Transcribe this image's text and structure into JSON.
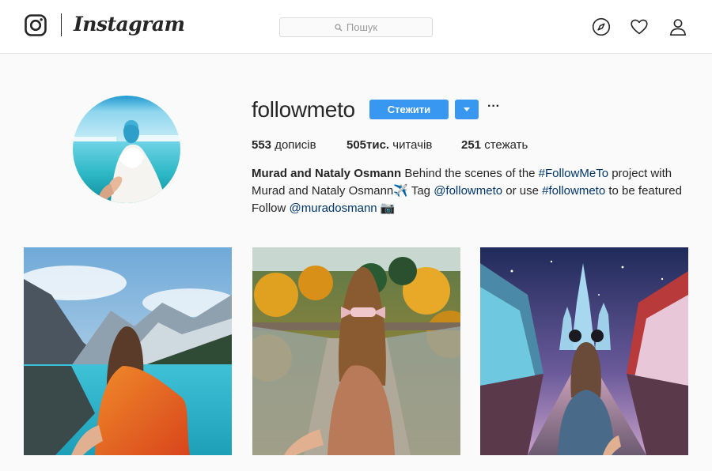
{
  "header": {
    "brand": "Instagram",
    "search_placeholder": "Пошук",
    "icons": [
      "camera-logo-icon",
      "compass-icon",
      "heart-icon",
      "person-icon"
    ]
  },
  "profile": {
    "username": "followmeto",
    "follow_label": "Стежити",
    "more_label": "···",
    "stats": {
      "posts_count": "553",
      "posts_label": "дописів",
      "followers_count": "505тис.",
      "followers_label": "читачів",
      "following_count": "251",
      "following_label": "стежать"
    },
    "bio": {
      "name": "Murad and Nataly Osmann",
      "text1": " Behind the scenes of the ",
      "hashtag1": "#FollowMeTo",
      "text2": " project with",
      "text3": "Murad and Nataly Osmann✈️ Tag ",
      "mention1": "@followmeto",
      "text4": " or use ",
      "hashtag2": "#followmeto",
      "text5": " to be featured",
      "text6": "Follow ",
      "mention2": "@muradosmann",
      "emoji": "📷"
    }
  },
  "posts": [
    {
      "label": "mountain-lake-post"
    },
    {
      "label": "suspension-bridge-post"
    },
    {
      "label": "disney-castle-post"
    }
  ],
  "colors": {
    "accent": "#3897f0",
    "link": "#003569",
    "text": "#262626",
    "background": "#fafafa"
  }
}
